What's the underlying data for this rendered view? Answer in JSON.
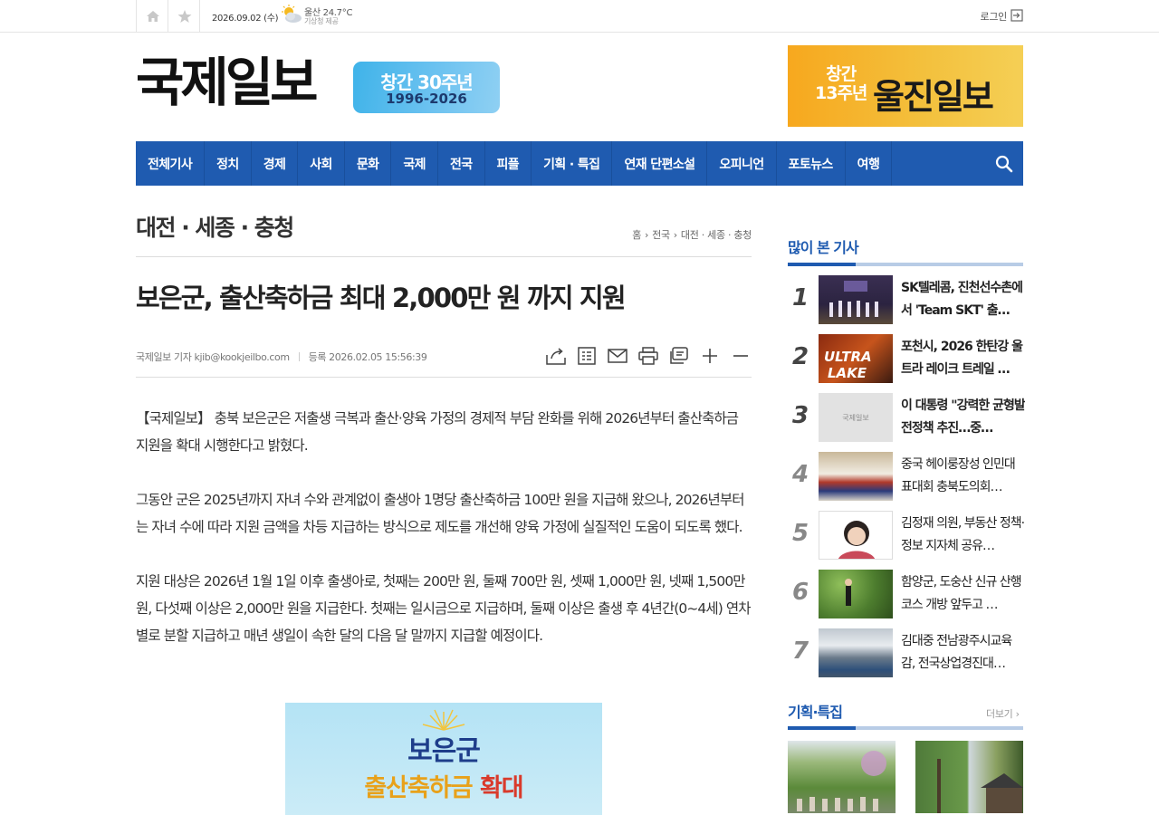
{
  "topbar": {
    "date": "2026.09.02 (수)",
    "weather_location_temp": "울산 24.7°C",
    "weather_source": "기상청 제공",
    "login_label": "로그인"
  },
  "header": {
    "logo_text": "국제일보",
    "anniversary_line1": "창간 30주년",
    "anniversary_line2": "1996-2026",
    "ad_small": "창간\n13주년",
    "ad_small_1": "창간",
    "ad_small_2": "13주년",
    "ad_main": "울진일보"
  },
  "nav": {
    "items": [
      "전체기사",
      "정치",
      "경제",
      "사회",
      "문화",
      "국제",
      "전국",
      "피플",
      "기획 · 특집",
      "연재 단편소설",
      "오피니언",
      "포토뉴스",
      "여행"
    ]
  },
  "article": {
    "section_title": "대전 · 세종 · 충청",
    "breadcrumb": [
      "홈",
      "전국",
      "대전 · 세종 · 충청"
    ],
    "headline": "보은군, 출산축하금 최대 2,000만 원 까지 지원",
    "author": "국제일보 기자 kjib@kookjeilbo.com",
    "registered": "등록 2026.02.05 15:56:39",
    "paragraphs": [
      "【국제일보】 충북 보은군은 저출생 극복과 출산·양육 가정의 경제적 부담 완화를 위해 2026년부터 출산축하금 지원을 확대 시행한다고 밝혔다.",
      "그동안 군은 2025년까지 자녀 수와 관계없이 출생아 1명당 출산축하금 100만 원을 지급해 왔으나, 2026년부터는 자녀 수에 따라 지원 금액을 차등 지급하는 방식으로 제도를 개선해 양육 가정에 실질적인 도움이 되도록 했다.",
      "지원 대상은 2026년 1월 1일 이후 출생아로, 첫째는 200만 원, 둘째 700만 원, 셋째 1,000만 원, 넷째 1,500만 원, 다섯째 이상은 2,000만 원을 지급한다. 첫째는 일시금으로 지급하며, 둘째 이상은 출생 후 4년간(0~4세) 연차별로 분할 지급하고 매년 생일이 속한 달의 다음 달 말까지 지급할 예정이다."
    ],
    "image_line1": "보은군",
    "image_line2a": "출산축하금 ",
    "image_line2b": "확대"
  },
  "sidebar": {
    "popular_title": "많이 본 기사",
    "popular": [
      {
        "num": "1",
        "title": "SK텔레콤, 진천선수촌에서 'Team SKT' 출…"
      },
      {
        "num": "2",
        "title": "포천시, 2026 한탄강 울트라 레이크 트레일 …"
      },
      {
        "num": "3",
        "title": "이 대통령 \"강력한 균형발전정책 추진…중…",
        "thumb_text": "국제일보"
      },
      {
        "num": "4",
        "title": "중국 헤이룽장성 인민대표대회 충북도의회…"
      },
      {
        "num": "5",
        "title": "김정재 의원, 부동산 정책· 정보 지자체 공유…"
      },
      {
        "num": "6",
        "title": "함양군, 도숭산 신규 산행 코스 개방 앞두고 …"
      },
      {
        "num": "7",
        "title": "김대중 전남광주시교육감, 전국상업경진대…"
      }
    ],
    "special_title": "기획·특집",
    "more_label": "더보기"
  }
}
